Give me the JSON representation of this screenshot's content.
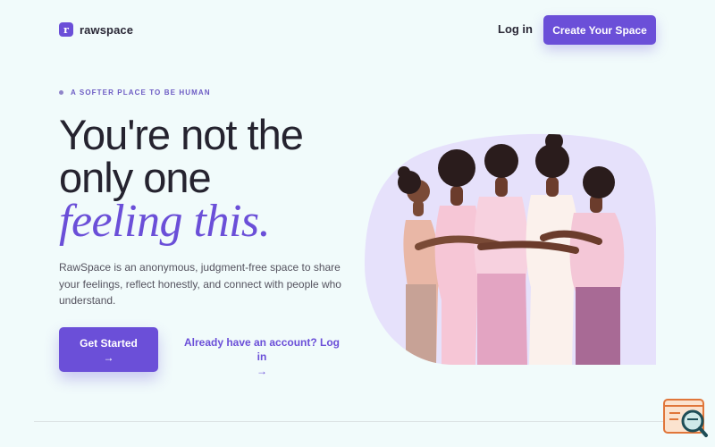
{
  "header": {
    "logo_letter": "r",
    "logo_text": "rawspace",
    "login_label": "Log in",
    "create_label": "Create Your Space"
  },
  "hero": {
    "eyebrow": "A SOFTER PLACE TO BE HUMAN",
    "headline_line1": "You're not the",
    "headline_line2": "only one",
    "headline_accent": "feeling this.",
    "description": "RawSpace is an anonymous, judgment-free space to share your feelings, reflect honestly, and connect with people who understand.",
    "start_label": "Get Started",
    "start_arrow": "→",
    "account_label": "Already have an account? Log in",
    "account_arrow": "→"
  },
  "colors": {
    "brand": "#6b4fd8",
    "background": "#f1fbfb",
    "text": "#23212e",
    "illustration_bg": "#e6e1fb"
  },
  "icons": {
    "logo": "r-logo-icon",
    "arrow": "arrow-right-icon",
    "widget": "search-chat-icon"
  }
}
